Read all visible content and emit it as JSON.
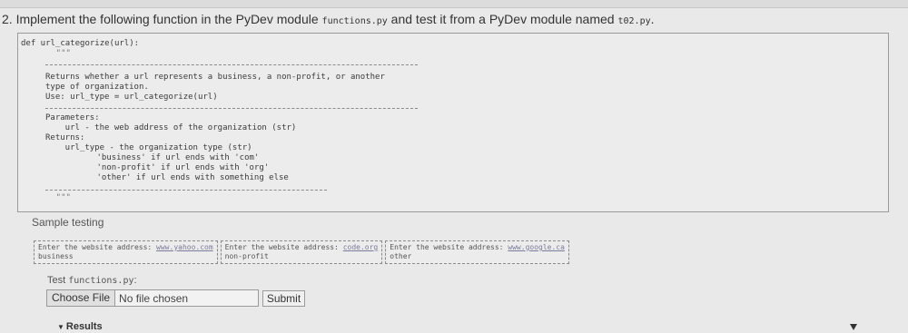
{
  "question": {
    "number": "2.",
    "text_before": " Implement the following function in the PyDev module ",
    "module": "functions.py",
    "text_mid": " and test it from a PyDev module named ",
    "test_module": "t02.py",
    "text_end": "."
  },
  "code": {
    "lines": [
      "def url_categorize(url):",
      "    \"\"\"",
      "Returns whether a url represents a business, a non-profit, or another",
      "type of organization.",
      "Use: url_type = url_categorize(url)",
      "Parameters:",
      "    url - the web address of the organization (str)",
      "Returns:",
      "    url_type - the organization type (str)",
      "      'business' if url ends with 'com'",
      "      'non-profit' if url ends with 'org'",
      "      'other' if url ends with something else",
      "    \"\"\""
    ]
  },
  "sample": {
    "label": "Sample testing",
    "cases": [
      {
        "prompt": "Enter the website address: ",
        "url": "www.yahoo.com",
        "result": "business"
      },
      {
        "prompt": "Enter the website address: ",
        "url": "code.org",
        "result": "non-profit"
      },
      {
        "prompt": "Enter the website address: ",
        "url": "www.google.ca",
        "result": "other"
      }
    ]
  },
  "upload": {
    "label_prefix": "Test ",
    "label_file": "functions.py",
    "label_suffix": ":",
    "choose_button": "Choose File",
    "file_status": "No file chosen",
    "submit_button": "Submit"
  },
  "results": {
    "label": "Results"
  }
}
